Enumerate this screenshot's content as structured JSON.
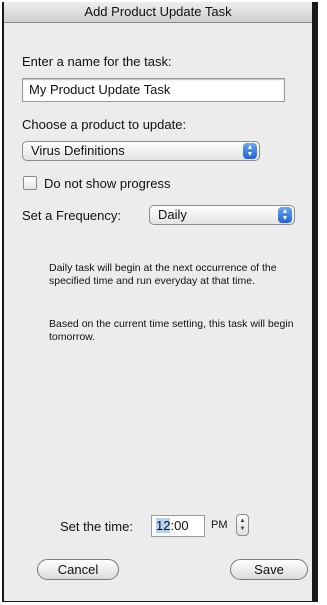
{
  "window": {
    "title": "Add Product Update Task"
  },
  "name_section": {
    "label": "Enter a name for the task:",
    "value": "My Product Update Task"
  },
  "product_section": {
    "label": "Choose a product to update:",
    "selected": "Virus Definitions"
  },
  "progress_checkbox": {
    "label": "Do not show progress",
    "checked": false
  },
  "frequency": {
    "label": "Set a Frequency:",
    "selected": "Daily"
  },
  "info": {
    "line1": "Daily task will begin at the next occurrence of the specified time and run everyday at that time.",
    "line2": "Based on the current time setting, this task will begin tomorrow."
  },
  "time": {
    "label": "Set the time:",
    "hour": "12",
    "separator": ":",
    "minute": "00",
    "ampm": "PM"
  },
  "buttons": {
    "cancel": "Cancel",
    "save": "Save"
  }
}
